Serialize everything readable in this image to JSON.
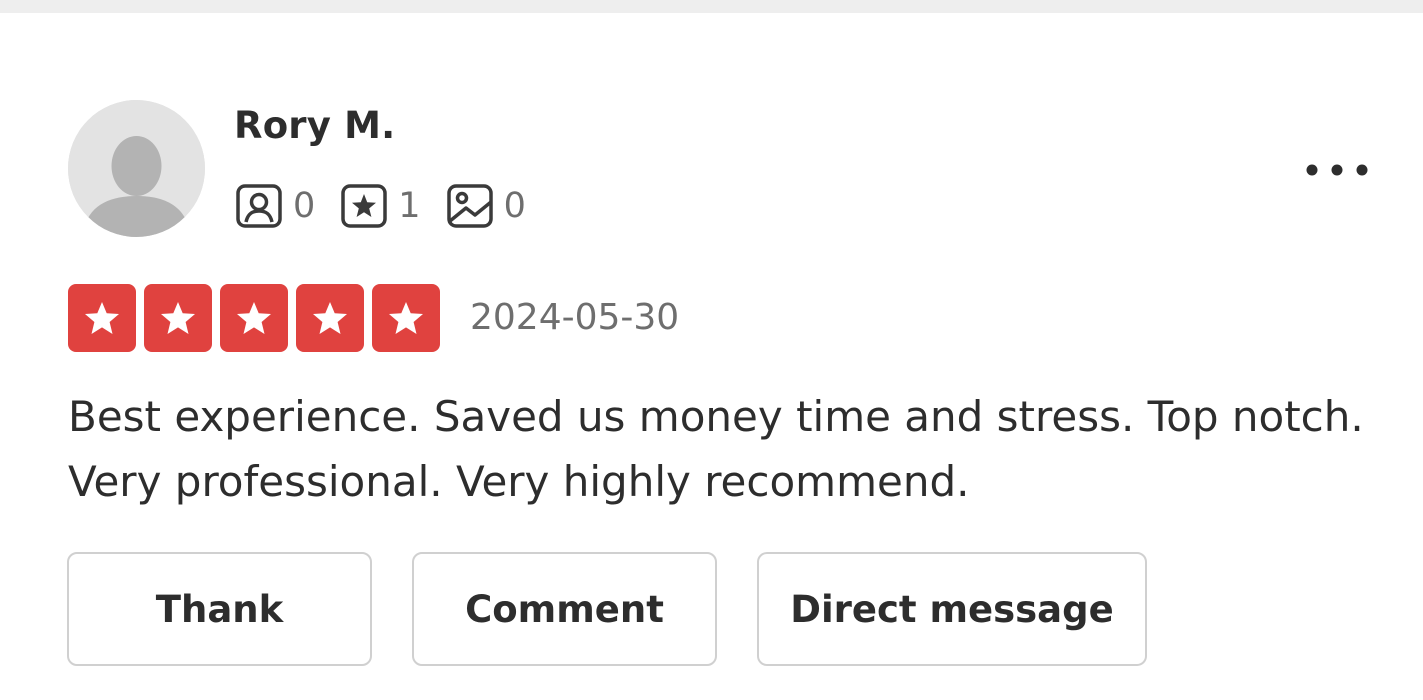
{
  "review": {
    "user": {
      "name": "Rory M.",
      "avatar_icon": "default-user-avatar-icon",
      "stats": {
        "friends": "0",
        "reviews": "1",
        "photos": "0"
      }
    },
    "rating": {
      "stars": 5,
      "max_stars": 5,
      "star_color": "#e0423f"
    },
    "date": "2024-05-30",
    "text": "Best experience. Saved us money time and stress. Top notch. Very professional. Very highly recommend."
  },
  "actions": {
    "thank_label": "Thank",
    "comment_label": "Comment",
    "direct_message_label": "Direct message"
  },
  "icons": {
    "friends": "friends-icon",
    "reviews": "review-star-icon",
    "photos": "photo-icon",
    "more": "more-options-icon"
  }
}
